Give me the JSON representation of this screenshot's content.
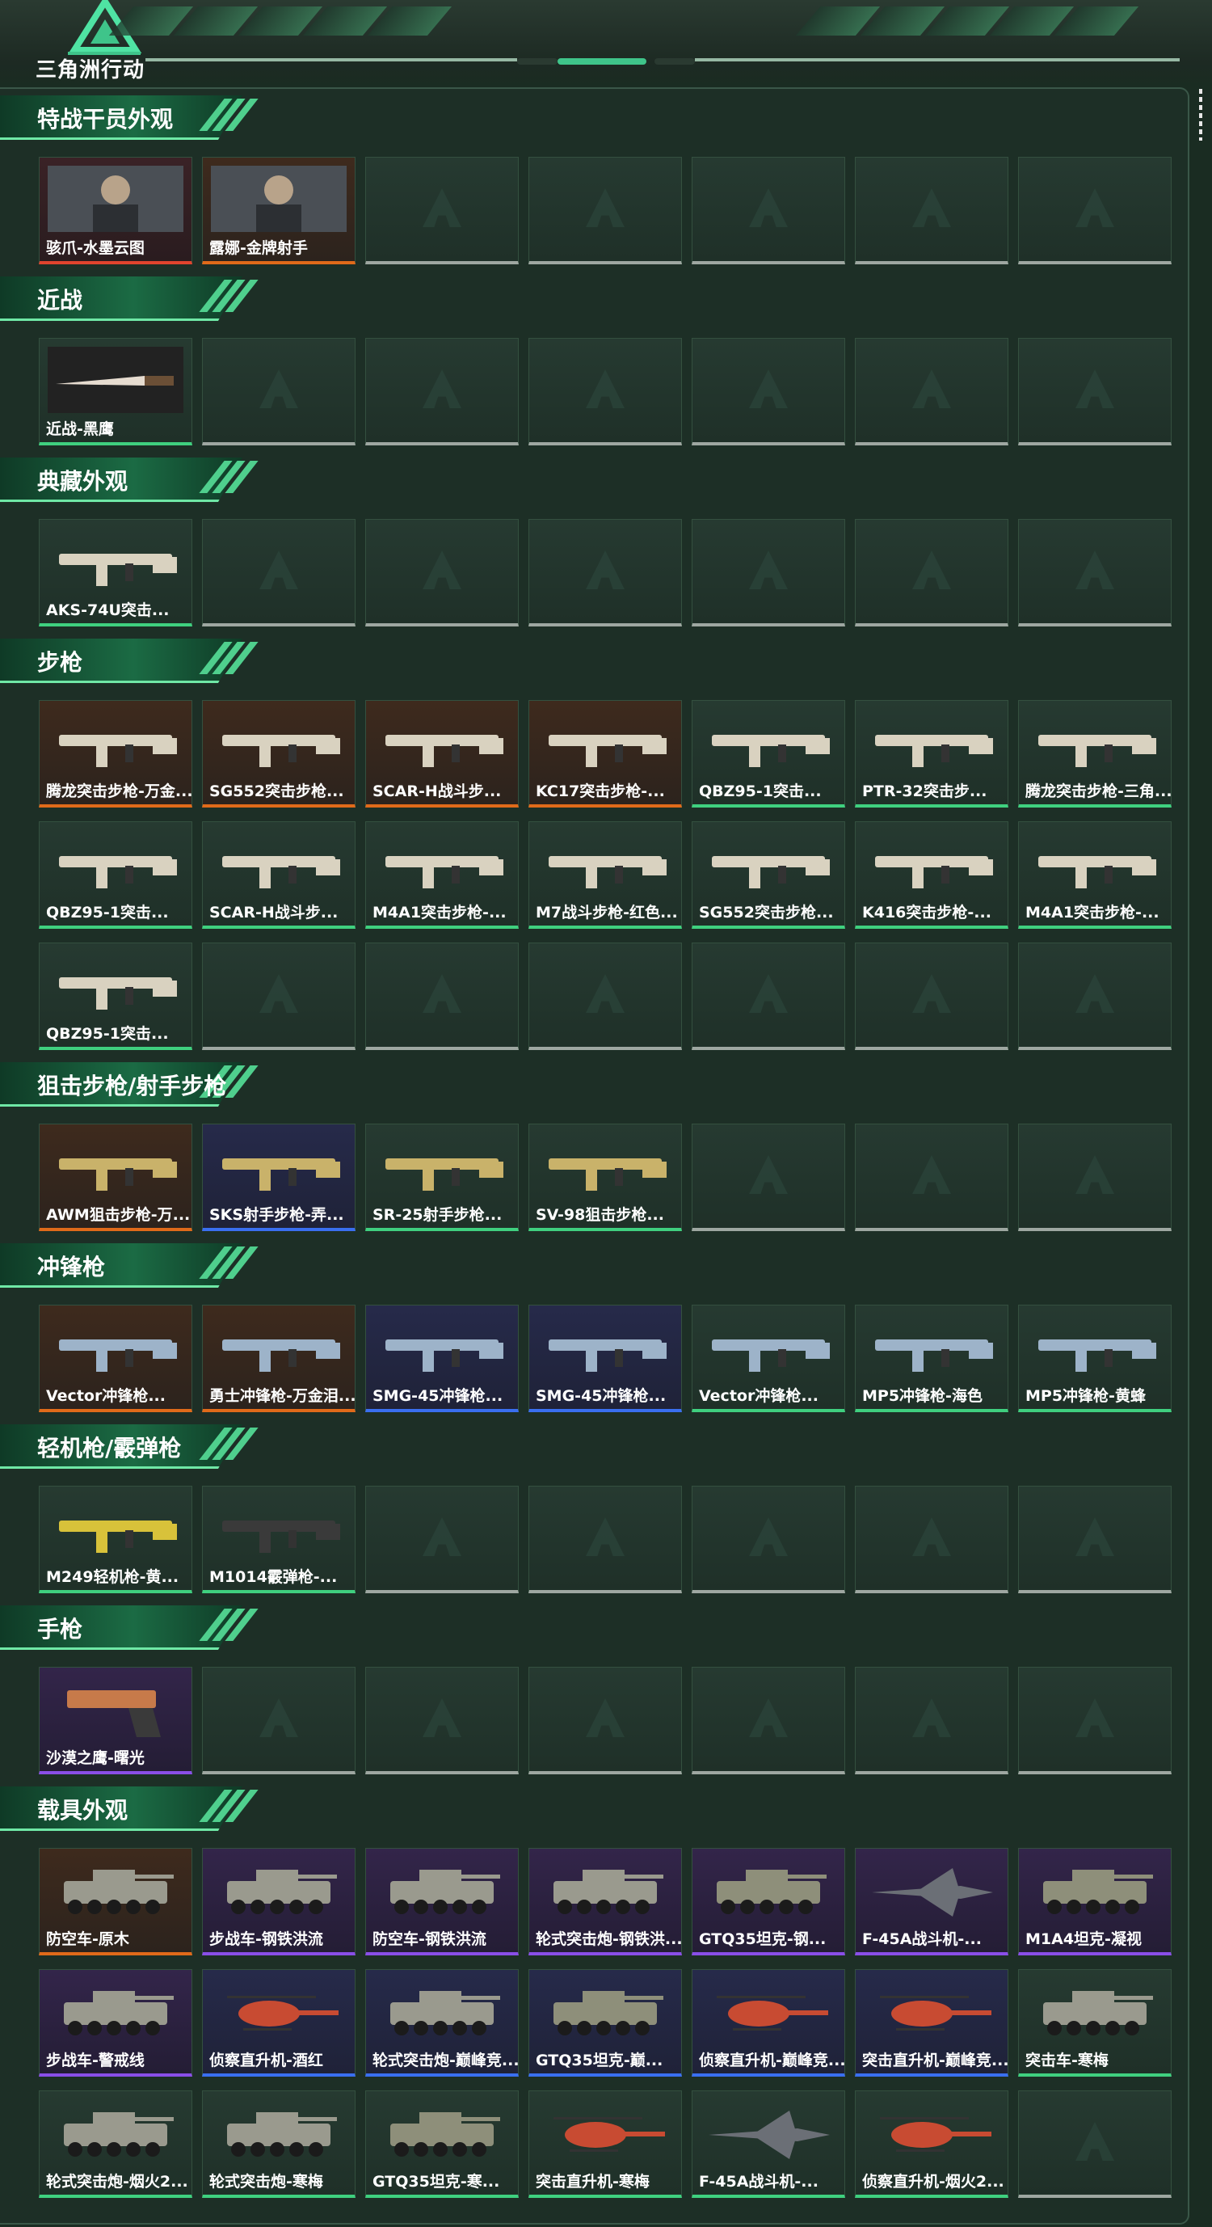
{
  "header": {
    "logo_text": "三角洲行动"
  },
  "sections": [
    {
      "title": "特战干员外观",
      "items": [
        {
          "label": "骇爪-水墨云图",
          "quality": "red",
          "icon": "operator-portrait"
        },
        {
          "label": "露娜-金牌射手",
          "quality": "orange",
          "icon": "operator-portrait"
        }
      ]
    },
    {
      "title": "近战",
      "items": [
        {
          "label": "近战-黑鹰",
          "quality": "green",
          "icon": "knife"
        }
      ]
    },
    {
      "title": "典藏外观",
      "items": [
        {
          "label": "AKS-74U突击...",
          "quality": "green",
          "icon": "rifle"
        }
      ]
    },
    {
      "title": "步枪",
      "items": [
        {
          "label": "腾龙突击步枪-万金...",
          "quality": "orange",
          "icon": "rifle"
        },
        {
          "label": "SG552突击步枪...",
          "quality": "orange",
          "icon": "rifle"
        },
        {
          "label": "SCAR-H战斗步...",
          "quality": "orange",
          "icon": "rifle"
        },
        {
          "label": "KC17突击步枪-...",
          "quality": "orange",
          "icon": "rifle"
        },
        {
          "label": "QBZ95-1突击...",
          "quality": "green",
          "icon": "rifle"
        },
        {
          "label": "PTR-32突击步...",
          "quality": "green",
          "icon": "rifle"
        },
        {
          "label": "腾龙突击步枪-三角...",
          "quality": "green",
          "icon": "rifle"
        },
        {
          "label": "QBZ95-1突击...",
          "quality": "green",
          "icon": "rifle"
        },
        {
          "label": "SCAR-H战斗步...",
          "quality": "green",
          "icon": "rifle"
        },
        {
          "label": "M4A1突击步枪-...",
          "quality": "green",
          "icon": "rifle"
        },
        {
          "label": "M7战斗步枪-红色...",
          "quality": "green",
          "icon": "rifle"
        },
        {
          "label": "SG552突击步枪...",
          "quality": "green",
          "icon": "rifle"
        },
        {
          "label": "K416突击步枪-...",
          "quality": "green",
          "icon": "rifle"
        },
        {
          "label": "M4A1突击步枪-...",
          "quality": "green",
          "icon": "rifle"
        },
        {
          "label": "QBZ95-1突击...",
          "quality": "green",
          "icon": "rifle"
        }
      ]
    },
    {
      "title": "狙击步枪/射手步枪",
      "items": [
        {
          "label": "AWM狙击步枪-万...",
          "quality": "orange",
          "icon": "sniper"
        },
        {
          "label": "SKS射手步枪-弄...",
          "quality": "blue",
          "icon": "sniper"
        },
        {
          "label": "SR-25射手步枪...",
          "quality": "green",
          "icon": "sniper"
        },
        {
          "label": "SV-98狙击步枪...",
          "quality": "green",
          "icon": "sniper"
        }
      ]
    },
    {
      "title": "冲锋枪",
      "items": [
        {
          "label": "Vector冲锋枪...",
          "quality": "orange",
          "icon": "smg"
        },
        {
          "label": "勇士冲锋枪-万金泪...",
          "quality": "orange",
          "icon": "smg"
        },
        {
          "label": "SMG-45冲锋枪...",
          "quality": "blue",
          "icon": "smg"
        },
        {
          "label": "SMG-45冲锋枪...",
          "quality": "blue",
          "icon": "smg"
        },
        {
          "label": "Vector冲锋枪...",
          "quality": "green",
          "icon": "smg"
        },
        {
          "label": "MP5冲锋枪-海色",
          "quality": "green",
          "icon": "smg"
        },
        {
          "label": "MP5冲锋枪-黄蜂",
          "quality": "green",
          "icon": "smg"
        }
      ]
    },
    {
      "title": "轻机枪/霰弹枪",
      "items": [
        {
          "label": "M249轻机枪-黄...",
          "quality": "green",
          "icon": "lmg"
        },
        {
          "label": "M1014霰弹枪-...",
          "quality": "green",
          "icon": "shotgun"
        }
      ]
    },
    {
      "title": "手枪",
      "items": [
        {
          "label": "沙漠之鹰-曙光",
          "quality": "purple",
          "icon": "pistol"
        }
      ]
    },
    {
      "title": "载具外观",
      "items": [
        {
          "label": "防空车-原木",
          "quality": "orange",
          "icon": "vehicle"
        },
        {
          "label": "步战车-钢铁洪流",
          "quality": "purple",
          "icon": "vehicle"
        },
        {
          "label": "防空车-钢铁洪流",
          "quality": "purple",
          "icon": "vehicle"
        },
        {
          "label": "轮式突击炮-钢铁洪...",
          "quality": "purple",
          "icon": "vehicle"
        },
        {
          "label": "GTQ35坦克-钢...",
          "quality": "purple",
          "icon": "tank"
        },
        {
          "label": "F-45A战斗机-...",
          "quality": "purple",
          "icon": "jet"
        },
        {
          "label": "M1A4坦克-凝视",
          "quality": "purple",
          "icon": "tank"
        },
        {
          "label": "步战车-警戒线",
          "quality": "purple",
          "icon": "vehicle"
        },
        {
          "label": "侦察直升机-酒红",
          "quality": "blue",
          "icon": "helicopter"
        },
        {
          "label": "轮式突击炮-巅峰竞...",
          "quality": "blue",
          "icon": "vehicle"
        },
        {
          "label": "GTQ35坦克-巅...",
          "quality": "blue",
          "icon": "tank"
        },
        {
          "label": "侦察直升机-巅峰竞...",
          "quality": "blue",
          "icon": "helicopter"
        },
        {
          "label": "突击直升机-巅峰竞...",
          "quality": "blue",
          "icon": "helicopter"
        },
        {
          "label": "突击车-寒梅",
          "quality": "green",
          "icon": "vehicle"
        },
        {
          "label": "轮式突击炮-烟火2...",
          "quality": "green",
          "icon": "vehicle"
        },
        {
          "label": "轮式突击炮-寒梅",
          "quality": "green",
          "icon": "vehicle"
        },
        {
          "label": "GTQ35坦克-寒...",
          "quality": "green",
          "icon": "tank"
        },
        {
          "label": "突击直升机-寒梅",
          "quality": "green",
          "icon": "helicopter"
        },
        {
          "label": "F-45A战斗机-...",
          "quality": "green",
          "icon": "jet"
        },
        {
          "label": "侦察直升机-烟火2...",
          "quality": "green",
          "icon": "helicopter"
        }
      ]
    }
  ]
}
